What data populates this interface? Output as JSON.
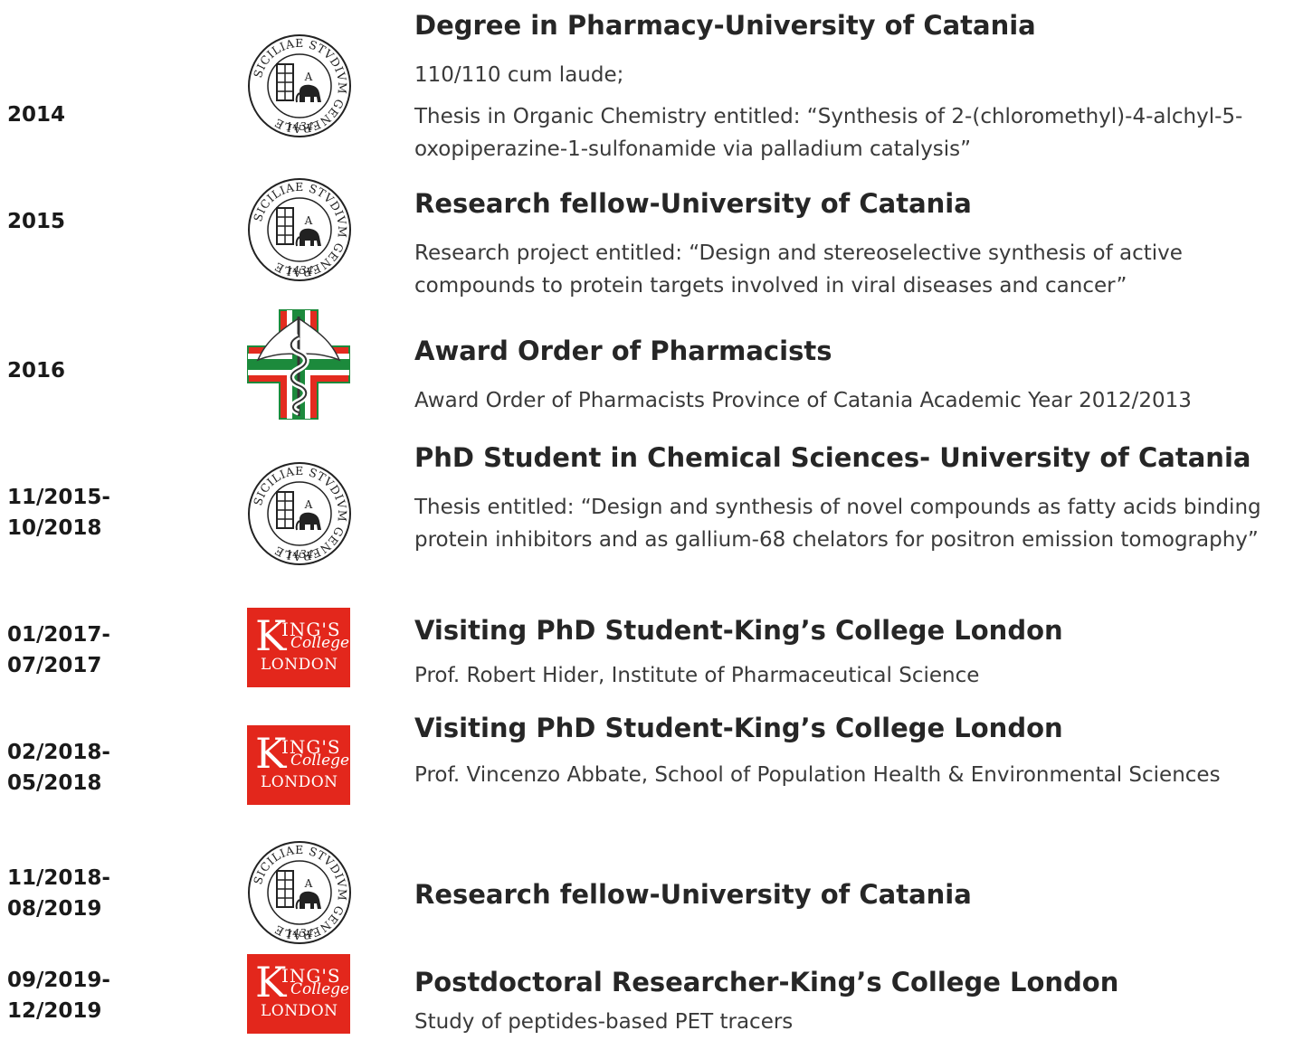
{
  "entries": [
    {
      "date": "2014",
      "logo": "university-seal-icon",
      "title": "Degree in Pharmacy-University of Catania",
      "lines": [
        "110/110 cum laude;",
        "Thesis in Organic Chemistry entitled: “Synthesis of 2-(chloromethyl)-4-alchyl-5-oxopiperazine-1-sulfonamide via palladium catalysis”"
      ]
    },
    {
      "date": "2015",
      "logo": "university-seal-icon",
      "title": "Research fellow-University of Catania",
      "lines": [
        "Research project entitled: “Design and stereoselective synthesis of active compounds to protein targets involved in viral diseases and cancer”"
      ]
    },
    {
      "date": "2016",
      "logo": "pharmacy-cross-icon",
      "title": "Award Order of Pharmacists",
      "lines": [
        "Award Order of Pharmacists Province of Catania Academic Year 2012/2013"
      ]
    },
    {
      "date": "11/2015-\n10/2018",
      "logo": "university-seal-icon",
      "title": "PhD Student in Chemical Sciences- University of Catania",
      "lines": [
        "Thesis entitled: “Design and synthesis of novel compounds as fatty acids binding protein inhibitors and as gallium-68 chelators for positron emission tomography”"
      ]
    },
    {
      "date": "01/2017-\n07/2017",
      "logo": "kings-college-logo",
      "title": "Visiting PhD Student-King’s College London",
      "lines": [
        "Prof. Robert Hider, Institute of Pharmaceutical Science"
      ]
    },
    {
      "date": "02/2018-\n05/2018",
      "logo": "kings-college-logo",
      "title": "Visiting PhD Student-King’s College London",
      "lines": [
        "Prof. Vincenzo Abbate, School of Population Health & Environmental Sciences"
      ]
    },
    {
      "date": "11/2018-\n08/2019",
      "logo": "university-seal-icon",
      "title": "Research fellow-University of Catania",
      "lines": []
    },
    {
      "date": "09/2019-\n12/2019",
      "logo": "kings-college-logo",
      "title": "Postdoctoral Researcher-King’s College London",
      "lines": [
        "Study of peptides-based PET tracers"
      ]
    }
  ],
  "seal": {
    "ring_text": "SICILIAE STVDIVM GENERALE",
    "year": "1434",
    "letter": "A"
  },
  "kings_logo": {
    "k": "K",
    "ings": "ING'S",
    "college": "College",
    "london": "LONDON"
  },
  "colors": {
    "kings_red": "#e3271c",
    "cross_red": "#e32b1f",
    "cross_green": "#1c8a3c"
  }
}
